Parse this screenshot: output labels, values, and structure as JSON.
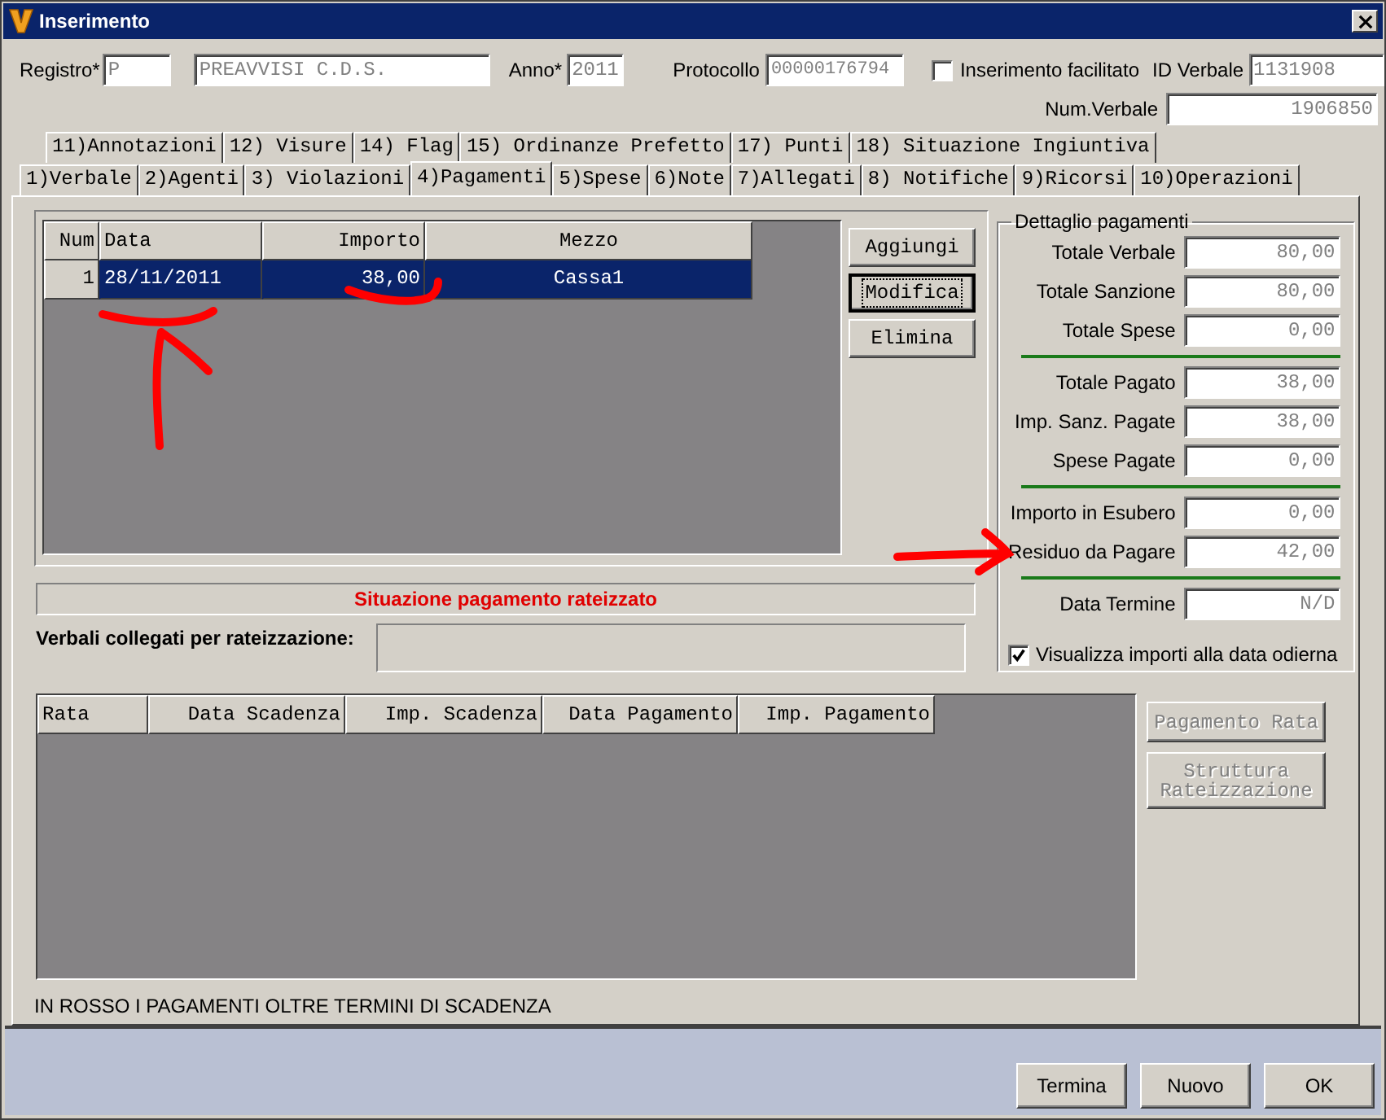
{
  "window": {
    "title": "Inserimento"
  },
  "header": {
    "registro": {
      "label": "Registro*",
      "value": "P"
    },
    "descrizione": {
      "value": "PREAVVISI C.D.S."
    },
    "anno": {
      "label": "Anno*",
      "value": "2011"
    },
    "protocollo": {
      "label": "Protocollo",
      "value": "00000176794"
    },
    "inserimento_facilitato": {
      "label": "Inserimento facilitato",
      "checked": false
    },
    "id_verbale": {
      "label": "ID Verbale",
      "value": "1131908"
    },
    "num_verbale": {
      "label": "Num.Verbale",
      "value": "1906850"
    }
  },
  "tabs_row1": [
    {
      "label": "11)Annotazioni",
      "selected": false
    },
    {
      "label": "12) Visure",
      "selected": false
    },
    {
      "label": "14) Flag",
      "selected": false
    },
    {
      "label": "15) Ordinanze Prefetto",
      "selected": false
    },
    {
      "label": "17) Punti",
      "selected": false
    },
    {
      "label": "18) Situazione Ingiuntiva",
      "selected": false
    }
  ],
  "tabs_row2": [
    {
      "label": "1)Verbale",
      "selected": false
    },
    {
      "label": "2)Agenti",
      "selected": false
    },
    {
      "label": "3) Violazioni",
      "selected": false
    },
    {
      "label": "4)Pagamenti",
      "selected": true
    },
    {
      "label": "5)Spese",
      "selected": false
    },
    {
      "label": "6)Note",
      "selected": false
    },
    {
      "label": "7)Allegati",
      "selected": false
    },
    {
      "label": "8) Notifiche",
      "selected": false
    },
    {
      "label": "9)Ricorsi",
      "selected": false
    },
    {
      "label": "10)Operazioni",
      "selected": false
    }
  ],
  "payments": {
    "columns": [
      "Num",
      "Data",
      "Importo",
      "Mezzo"
    ],
    "rows": [
      {
        "cells": [
          "1",
          "28/11/2011",
          "38,00",
          "Cassa1"
        ],
        "selected": true
      }
    ]
  },
  "payment_buttons": [
    {
      "label": "Aggiungi",
      "focused": false
    },
    {
      "label": "Modifica",
      "focused": true
    },
    {
      "label": "Elimina",
      "focused": false
    }
  ],
  "dettaglio": {
    "title": "Dettaglio pagamenti",
    "groups": [
      [
        {
          "label": "Totale Verbale",
          "value": "80,00"
        },
        {
          "label": "Totale Sanzione",
          "value": "80,00"
        },
        {
          "label": "Totale Spese",
          "value": "0,00"
        }
      ],
      [
        {
          "label": "Totale Pagato",
          "value": "38,00"
        },
        {
          "label": "Imp. Sanz. Pagate",
          "value": "38,00"
        },
        {
          "label": "Spese Pagate",
          "value": "0,00"
        }
      ],
      [
        {
          "label": "Importo in Esubero",
          "value": "0,00"
        },
        {
          "label": "Residuo da Pagare",
          "value": "42,00"
        }
      ],
      [
        {
          "label": "Data Termine",
          "value": "N/D"
        }
      ]
    ],
    "checkbox": {
      "label": "Visualizza importi alla data odierna",
      "checked": true
    }
  },
  "rateizzazione": {
    "banner": "Situazione pagamento rateizzato",
    "verbali_label": "Verbali collegati per rateizzazione:",
    "columns": [
      "Rata",
      "Data Scadenza",
      "Imp. Scadenza",
      "Data Pagamento",
      "Imp. Pagamento"
    ],
    "buttons": [
      {
        "label": "Pagamento Rata",
        "disabled": true
      },
      {
        "label": "Struttura Rateizzazione",
        "disabled": true
      }
    ],
    "note": "IN ROSSO I PAGAMENTI OLTRE TERMINI DI SCADENZA"
  },
  "footer_buttons": [
    "Termina",
    "Nuovo",
    "OK"
  ]
}
